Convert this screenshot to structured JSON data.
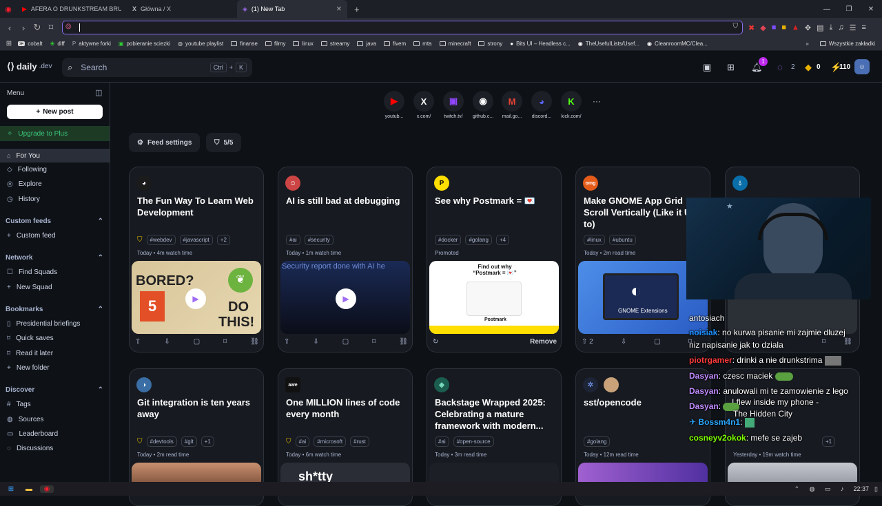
{
  "browser": {
    "tabs": [
      {
        "label": "AFERA O DRUNKSTREAM BRUCEI!? N",
        "icon": "youtube-icon"
      },
      {
        "label": "Główna / X",
        "icon": "x-icon"
      },
      {
        "label": "(1) New Tab",
        "icon": "daily-dev-icon"
      }
    ],
    "bookmarks": [
      "cobalt",
      "diff",
      "aktywne forki",
      "pobieranie sciezki",
      "youtube playlist",
      "finanse",
      "filmy",
      "linux",
      "streamy",
      "java",
      "fivem",
      "mta",
      "minecraft",
      "strony",
      "Bits UI – Headless c...",
      "TheUsefulLists/Usef...",
      "CleanroomMC/Clea..."
    ],
    "all_bookmarks": "Wszystkie zakładki"
  },
  "header": {
    "logo": "daily",
    "logo_suffix": ".dev",
    "search_placeholder": "Search",
    "kbd1": "Ctrl",
    "kbd_plus": "+",
    "kbd2": "K",
    "notif_count": "1",
    "streak": "2",
    "coins": "0",
    "reputation": "110"
  },
  "sidebar": {
    "menu_label": "Menu",
    "new_post": "New post",
    "upgrade": "Upgrade to Plus",
    "for_you": "For You",
    "following": "Following",
    "explore": "Explore",
    "history": "History",
    "custom_feeds": "Custom feeds",
    "custom_feed": "Custom feed",
    "network": "Network",
    "find_squads": "Find Squads",
    "new_squad": "New Squad",
    "bookmarks": "Bookmarks",
    "presidential": "Presidential briefings",
    "quick_saves": "Quick saves",
    "read_later": "Read it later",
    "new_folder": "New folder",
    "discover": "Discover",
    "tags": "Tags",
    "sources": "Sources",
    "leaderboard": "Leaderboard",
    "discussions": "Discussions"
  },
  "shortcuts": [
    {
      "label": "youtub...",
      "glyph": "▶",
      "color": "#ff0000"
    },
    {
      "label": "x.com/",
      "glyph": "X",
      "color": "#ffffff"
    },
    {
      "label": "twitch.tv/",
      "glyph": "▣",
      "color": "#9146ff"
    },
    {
      "label": "github.c...",
      "glyph": "◉",
      "color": "#ffffff"
    },
    {
      "label": "mail.go...",
      "glyph": "M",
      "color": "#ea4335"
    },
    {
      "label": "discord...",
      "glyph": "◕",
      "color": "#5865f2"
    },
    {
      "label": "kick.com/",
      "glyph": "K",
      "color": "#53fc18"
    }
  ],
  "feed": {
    "settings": "Feed settings",
    "count": "5/5"
  },
  "cards": [
    {
      "title": "The Fun Way To Learn Web Development",
      "tags": [
        "#webdev",
        "#javascript",
        "+2"
      ],
      "meta": "Today • 4m watch time"
    },
    {
      "title": "AI is still bad at debugging",
      "tags": [
        "#ai",
        "#security"
      ],
      "meta": "Today • 1m watch time"
    },
    {
      "title": "See why Postmark = 💌",
      "tags": [
        "#docker",
        "#golang",
        "+4"
      ],
      "meta": "Promoted",
      "remove": "Remove"
    },
    {
      "title": "Make GNOME App Grid Scroll Vertically (Like it Used to)",
      "tags": [
        "#linux",
        "#ubuntu"
      ],
      "meta": "Today • 2m read time",
      "upvotes": "2"
    },
    {
      "title": "Git integration is ten years away",
      "tags": [
        "#devtools",
        "#git",
        "+1"
      ],
      "meta": "Today • 2m read time"
    },
    {
      "title": "One MILLION lines of code every month",
      "tags": [
        "#ai",
        "#microsoft",
        "#rust"
      ],
      "meta": "Today • 6m watch time"
    },
    {
      "title": "Backstage Wrapped 2025: Celebrating a mature framework with modern...",
      "tags": [
        "#ai",
        "#open-source"
      ],
      "meta": "Today • 3m read time"
    },
    {
      "title": "sst/opencode",
      "tags": [
        "#golang"
      ],
      "meta": "Today • 12m read time"
    },
    {
      "title": "",
      "tags": [
        "+1"
      ],
      "meta": "Yesterday • 19m watch time"
    }
  ],
  "card_images": {
    "bored": "BORED?",
    "do": "DO",
    "this": "THIS!",
    "debug_text": "Security report done with AI he",
    "postmark_head": "Find out why “Postmark = 💌”",
    "postmark_brand": "Postmark",
    "gnome": "GNOME Extensions",
    "shitty": "sh*tty"
  },
  "chat": [
    {
      "user": "antosiach",
      "color": "#ffffff",
      "msg": ""
    },
    {
      "user": "noisiak",
      "color": "#1e90ff",
      "msg": ": no kurwa pisanie mi zajmie dluzej"
    },
    {
      "user": "",
      "color": "#ffffff",
      "msg": "niz napisanie jak to dziala"
    },
    {
      "user": "piotrgamer",
      "color": "#ff3b3b",
      "msg": ": drinki a nie drunkstrima"
    },
    {
      "user": "Dasyan",
      "color": "#c08bff",
      "msg": ": czesc maciek"
    },
    {
      "user": "Dasyan",
      "color": "#c08bff",
      "msg": ": anulowali mi te zamowienie z lego"
    },
    {
      "user": "Dasyan",
      "color": "#c08bff",
      "msg": ": "
    },
    {
      "user": "Bossm4n1",
      "color": "#2aa7ff",
      "msg": ": "
    },
    {
      "user": "cosneyv2okok",
      "color": "#7fff00",
      "msg": ": mefe se zajeb"
    }
  ],
  "chat_overlay": {
    "line1": "I flew inside my phone -",
    "line2": "The Hidden City"
  },
  "clock": "22:37"
}
